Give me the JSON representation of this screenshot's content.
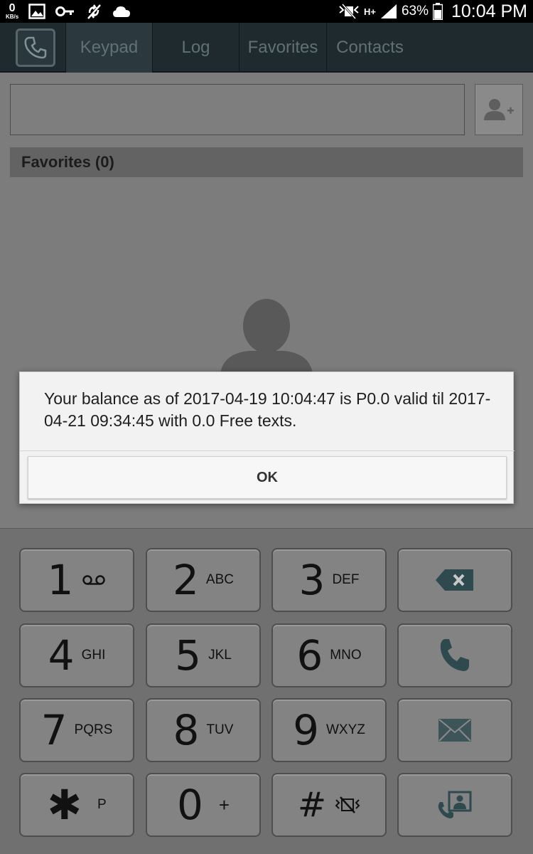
{
  "status_bar": {
    "kbs_value": "0",
    "kbs_unit": "KB/s",
    "network_type": "H+",
    "battery_percent": "63%",
    "time": "10:04 PM",
    "icons": [
      "image-icon",
      "key-icon",
      "no-sync-icon",
      "cloud-icon",
      "mute-icon",
      "signal-icon",
      "battery-icon"
    ]
  },
  "tabs": [
    {
      "label": "Keypad",
      "active": true
    },
    {
      "label": "Log",
      "active": false
    },
    {
      "label": "Favorites",
      "active": false
    },
    {
      "label": "Contacts",
      "active": false
    }
  ],
  "number_field": {
    "value": ""
  },
  "favorites_header": "Favorites (0)",
  "dialog": {
    "message": "Your balance as of 2017-04-19 10:04:47 is P0.0 valid til 2017-04-21 09:34:45 with 0.0 Free texts.",
    "ok_label": "OK"
  },
  "keypad": {
    "rows": [
      [
        {
          "digit": "1",
          "letters": ""
        },
        {
          "digit": "2",
          "letters": "ABC"
        },
        {
          "digit": "3",
          "letters": "DEF"
        }
      ],
      [
        {
          "digit": "4",
          "letters": "GHI"
        },
        {
          "digit": "5",
          "letters": "JKL"
        },
        {
          "digit": "6",
          "letters": "MNO"
        }
      ],
      [
        {
          "digit": "7",
          "letters": "PQRS"
        },
        {
          "digit": "8",
          "letters": "TUV"
        },
        {
          "digit": "9",
          "letters": "WXYZ"
        }
      ],
      [
        {
          "digit": "✱",
          "letters": "P"
        },
        {
          "digit": "0",
          "letters": "+"
        },
        {
          "digit": "#",
          "letters": ""
        }
      ]
    ],
    "action_icons": [
      "backspace-icon",
      "call-icon",
      "message-icon",
      "video-call-icon"
    ]
  },
  "colors": {
    "tab_bar": "#1f2a2e",
    "overlay_background": "#7c7c7c",
    "dialog_background": "#f2f2f2"
  }
}
